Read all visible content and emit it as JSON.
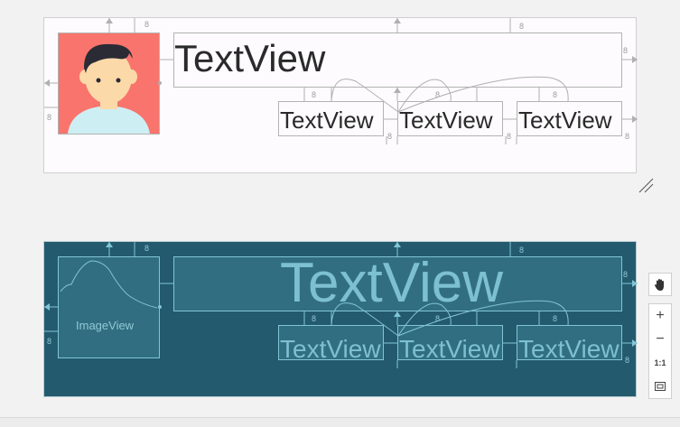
{
  "design": {
    "title_text": "TextView",
    "row_texts": [
      "TextView",
      "TextView",
      "TextView"
    ],
    "margin": "8",
    "avatar_colors": {
      "bg": "#f8746c",
      "face": "#fcd9a8",
      "hair": "#2b2b36",
      "shirt": "#cdeef3"
    }
  },
  "blueprint": {
    "image_label": "ImageView",
    "title_text": "TextView",
    "row_texts": [
      "TextView",
      "TextView",
      "TextView"
    ],
    "margin": "8",
    "colors": {
      "bg": "#235a6e",
      "line": "#80c5d5",
      "text": "#7dc0d0"
    }
  },
  "toolbar": {
    "pan_icon": "hand-icon",
    "zoom_in": "+",
    "zoom_out": "−",
    "actual_size": "1:1",
    "fit_icon": "fit-screen-icon"
  }
}
